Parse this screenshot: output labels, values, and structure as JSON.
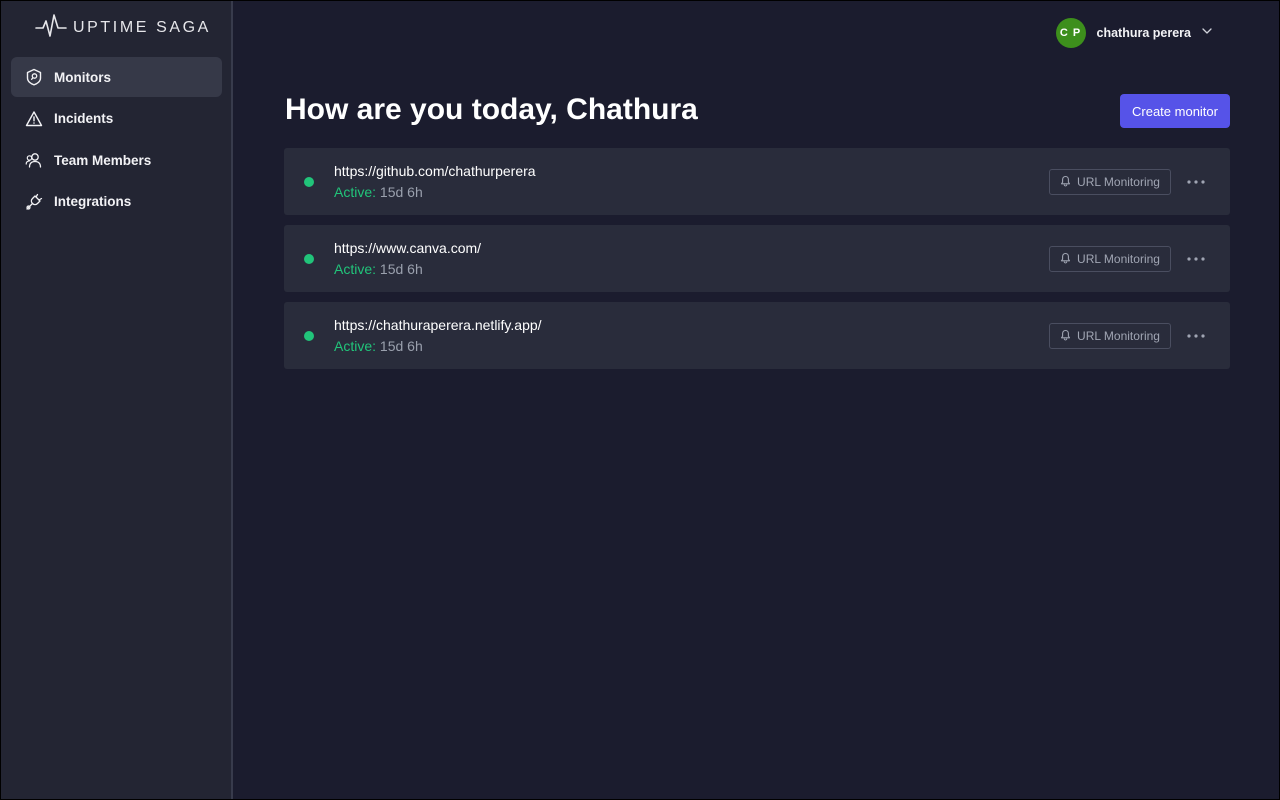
{
  "app": {
    "logo_text": "UPTIME SAGA"
  },
  "sidebar": {
    "items": [
      {
        "label": "Monitors",
        "icon": "shield-icon",
        "active": true
      },
      {
        "label": "Incidents",
        "icon": "warning-icon",
        "active": false
      },
      {
        "label": "Team Members",
        "icon": "team-icon",
        "active": false
      },
      {
        "label": "Integrations",
        "icon": "plug-icon",
        "active": false
      }
    ]
  },
  "header": {
    "avatar_initials": "C P",
    "user_name": "chathura perera",
    "dropdown_icon": "chevron-down-icon"
  },
  "main": {
    "title": "How are you today, Chathura",
    "create_button": "Create monitor",
    "monitors": [
      {
        "url": "https://github.com/chathurperera",
        "status_label": "Active:",
        "uptime": "15d 6h",
        "type": "URL Monitoring"
      },
      {
        "url": "https://www.canva.com/",
        "status_label": "Active:",
        "uptime": "15d 6h",
        "type": "URL Monitoring"
      },
      {
        "url": "https://chathuraperera.netlify.app/",
        "status_label": "Active:",
        "uptime": "15d 6h",
        "type": "URL Monitoring"
      }
    ]
  },
  "colors": {
    "accent": "#5653e8",
    "status_active": "#21c47a",
    "avatar": "#3d8f1c"
  }
}
